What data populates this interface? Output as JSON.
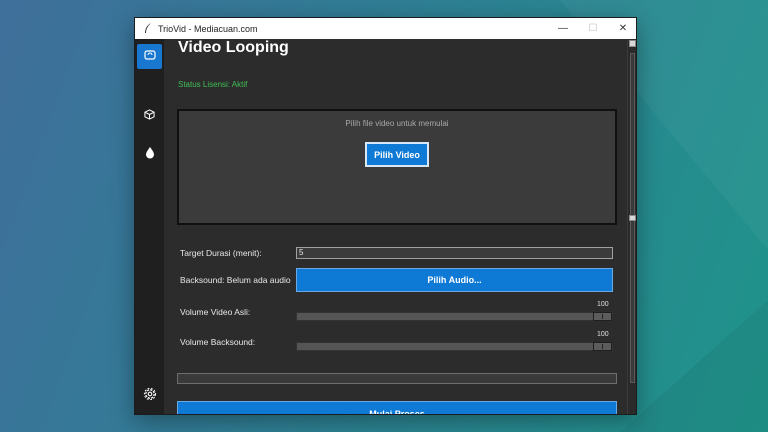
{
  "window": {
    "title": "TrioVid - Mediacuan.com",
    "controls": {
      "minimize": "—",
      "maximize": "☐",
      "close": "✕"
    }
  },
  "sidebar": {
    "items": [
      {
        "icon": "video-loop-icon",
        "active": true
      },
      {
        "icon": "cube-icon",
        "active": false
      },
      {
        "icon": "drop-icon",
        "active": false
      }
    ],
    "settings_icon": "gear-icon"
  },
  "main": {
    "title": "Video Looping",
    "license_status": "Status Lisensi: Aktif",
    "dropzone": {
      "hint": "Pilih file video untuk memulai",
      "button": "Pilih Video"
    },
    "target_duration": {
      "label": "Target Durasi (menit):",
      "value": "5"
    },
    "backsound": {
      "label": "Backsound: Belum ada audio",
      "button": "Pilih Audio..."
    },
    "volume_video": {
      "label": "Volume Video Asli:",
      "value": "100",
      "level": 1.0
    },
    "volume_backsound": {
      "label": "Volume Backsound:",
      "value": "100",
      "level": 1.0
    },
    "progress": 0,
    "start_button": "Mulai Proses"
  },
  "colors": {
    "accent": "#0f7ad6",
    "license_green": "#3fbf55",
    "window_bg": "#2c2c2c"
  }
}
